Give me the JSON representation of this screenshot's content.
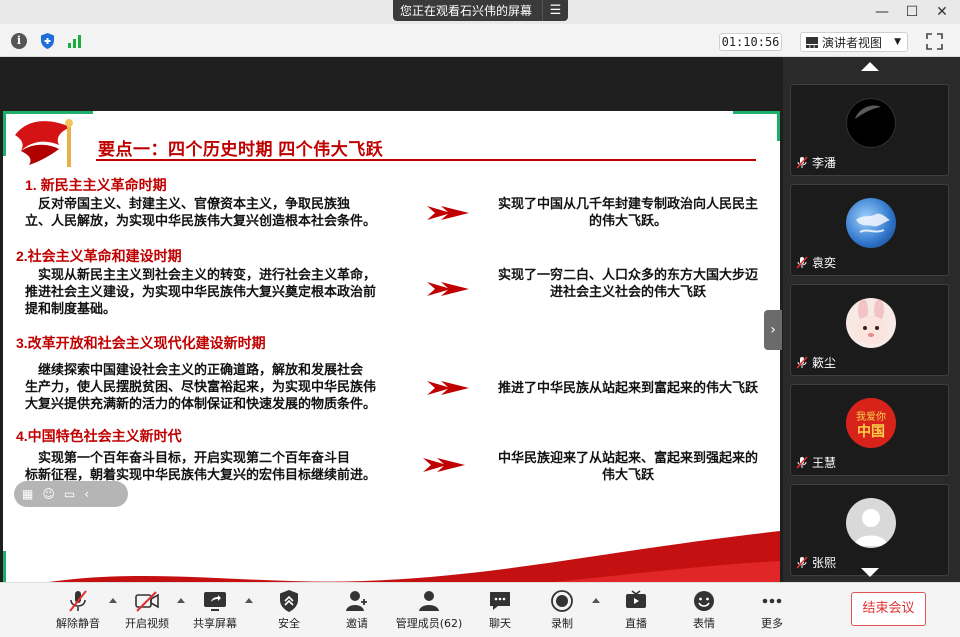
{
  "window": {
    "share_banner": "您正在观看石兴伟的屏幕",
    "menu_icon": "menu-icon",
    "minimize": "—",
    "maximize": "☐",
    "close": "✕"
  },
  "infobar": {
    "info_icon_text": "i",
    "timer": "01:10:56",
    "view_mode": "演讲者视图"
  },
  "slide": {
    "title": "要点一：四个历史时期  四个伟大飞跃",
    "sections": [
      {
        "heading": "1. 新民主主义革命时期",
        "body_lines": [
          "　反对帝国主义、封建主义、官僚资本主义，争取民族独",
          "立、人民解放，为实现中华民族伟大复兴创造根本社会条件。"
        ],
        "result_lines": [
          "实现了中国从几千年封建专制政治向人民民主",
          "的伟大飞跃。"
        ]
      },
      {
        "heading": "2.社会主义革命和建设时期",
        "body_lines": [
          "　实现从新民主主义到社会主义的转变，进行社会主义革命，",
          "推进社会主义建设，为实现中华民族伟大复兴奠定根本政治前",
          "提和制度基础。"
        ],
        "result_lines": [
          "实现了一穷二白、人口众多的东方大国大步迈",
          "进社会主义社会的伟大飞跃"
        ]
      },
      {
        "heading": "3.改革开放和社会主义现代化建设新时期",
        "body_lines": [
          "　继续探索中国建设社会主义的正确道路，解放和发展社会",
          "生产力，使人民摆脱贫困、尽快富裕起来，为实现中华民族伟",
          "大复兴提供充满新的活力的体制保证和快速发展的物质条件。"
        ],
        "result_lines": [
          "推进了中华民族从站起来到富起来的伟大飞跃"
        ]
      },
      {
        "heading": "4.中国特色社会主义新时代",
        "body_lines": [
          "　实现第一个百年奋斗目标，开启实现第二个百年奋斗目",
          "标新征程，朝着实现中华民族伟大复兴的宏伟目标继续前进。"
        ],
        "result_lines": [
          "中华民族迎来了从站起来、富起来到强起来的",
          "伟大飞跃"
        ]
      }
    ]
  },
  "participants": [
    {
      "name": "李潘",
      "avatar": "dark-moon-avatar"
    },
    {
      "name": "袁奕",
      "avatar": "earth-avatar"
    },
    {
      "name": "簌尘",
      "avatar": "bunny-avatar"
    },
    {
      "name": "王慧",
      "avatar": "love-china-avatar",
      "avatar_text": "我爱你中国"
    },
    {
      "name": "张熙",
      "avatar": "default-avatar"
    }
  ],
  "controls": {
    "unmute": "解除静音",
    "start_video": "开启视频",
    "share_screen": "共享屏幕",
    "security": "安全",
    "invite": "邀请",
    "manage_members": "管理成员(62)",
    "chat": "聊天",
    "record": "录制",
    "live": "直播",
    "reactions": "表情",
    "more": "更多",
    "end_meeting": "结束会议"
  },
  "colors": {
    "accent_red": "#c00000",
    "green_frame": "#1fae6b",
    "end_red": "#e03030"
  }
}
